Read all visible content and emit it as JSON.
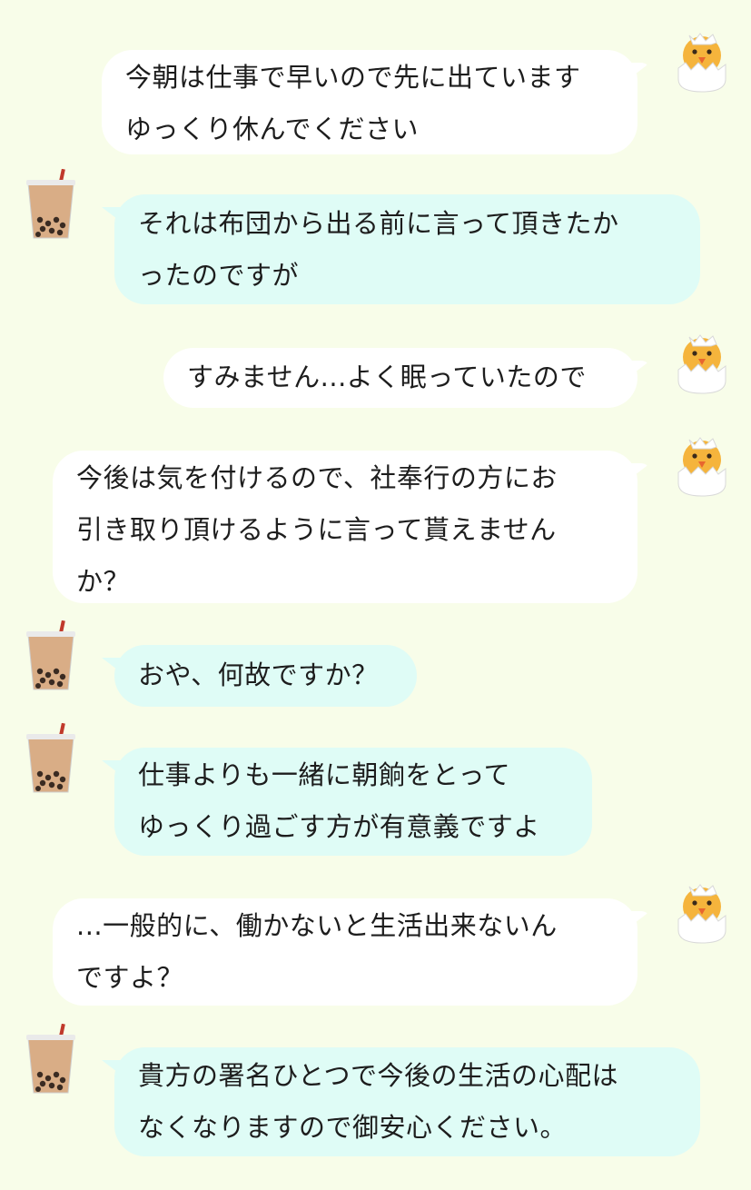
{
  "messages": [
    {
      "sender": "chick",
      "lines": [
        "今朝は仕事で早いので先に出ています",
        "ゆっくり休んでください"
      ]
    },
    {
      "sender": "tea",
      "lines": [
        "それは布団から出る前に言って頂きたか",
        "ったのですが"
      ]
    },
    {
      "sender": "chick",
      "lines": [
        "すみません...よく眠っていたので"
      ]
    },
    {
      "sender": "chick",
      "lines": [
        "今後は気を付けるので、社奉行の方にお",
        "引き取り頂けるように言って貰えません",
        "か？"
      ]
    },
    {
      "sender": "tea",
      "lines": [
        "おや、何故ですか？"
      ]
    },
    {
      "sender": "tea",
      "lines": [
        "仕事よりも一緒に朝餉をとって",
        "ゆっくり過ごす方が有意義ですよ"
      ]
    },
    {
      "sender": "chick",
      "lines": [
        "...一般的に、働かないと生活出来ないん",
        "ですよ？"
      ]
    },
    {
      "sender": "tea",
      "lines": [
        "貴方の署名ひとつで今後の生活の心配は",
        "なくなりますので御安心ください。"
      ]
    }
  ],
  "colors": {
    "background": "#f8fde9",
    "chick_bubble": "#ffffff",
    "tea_bubble": "#dffcf6"
  },
  "icons": {
    "chick_avatar": "chick-in-eggshell-icon",
    "tea_avatar": "bubble-tea-icon"
  }
}
